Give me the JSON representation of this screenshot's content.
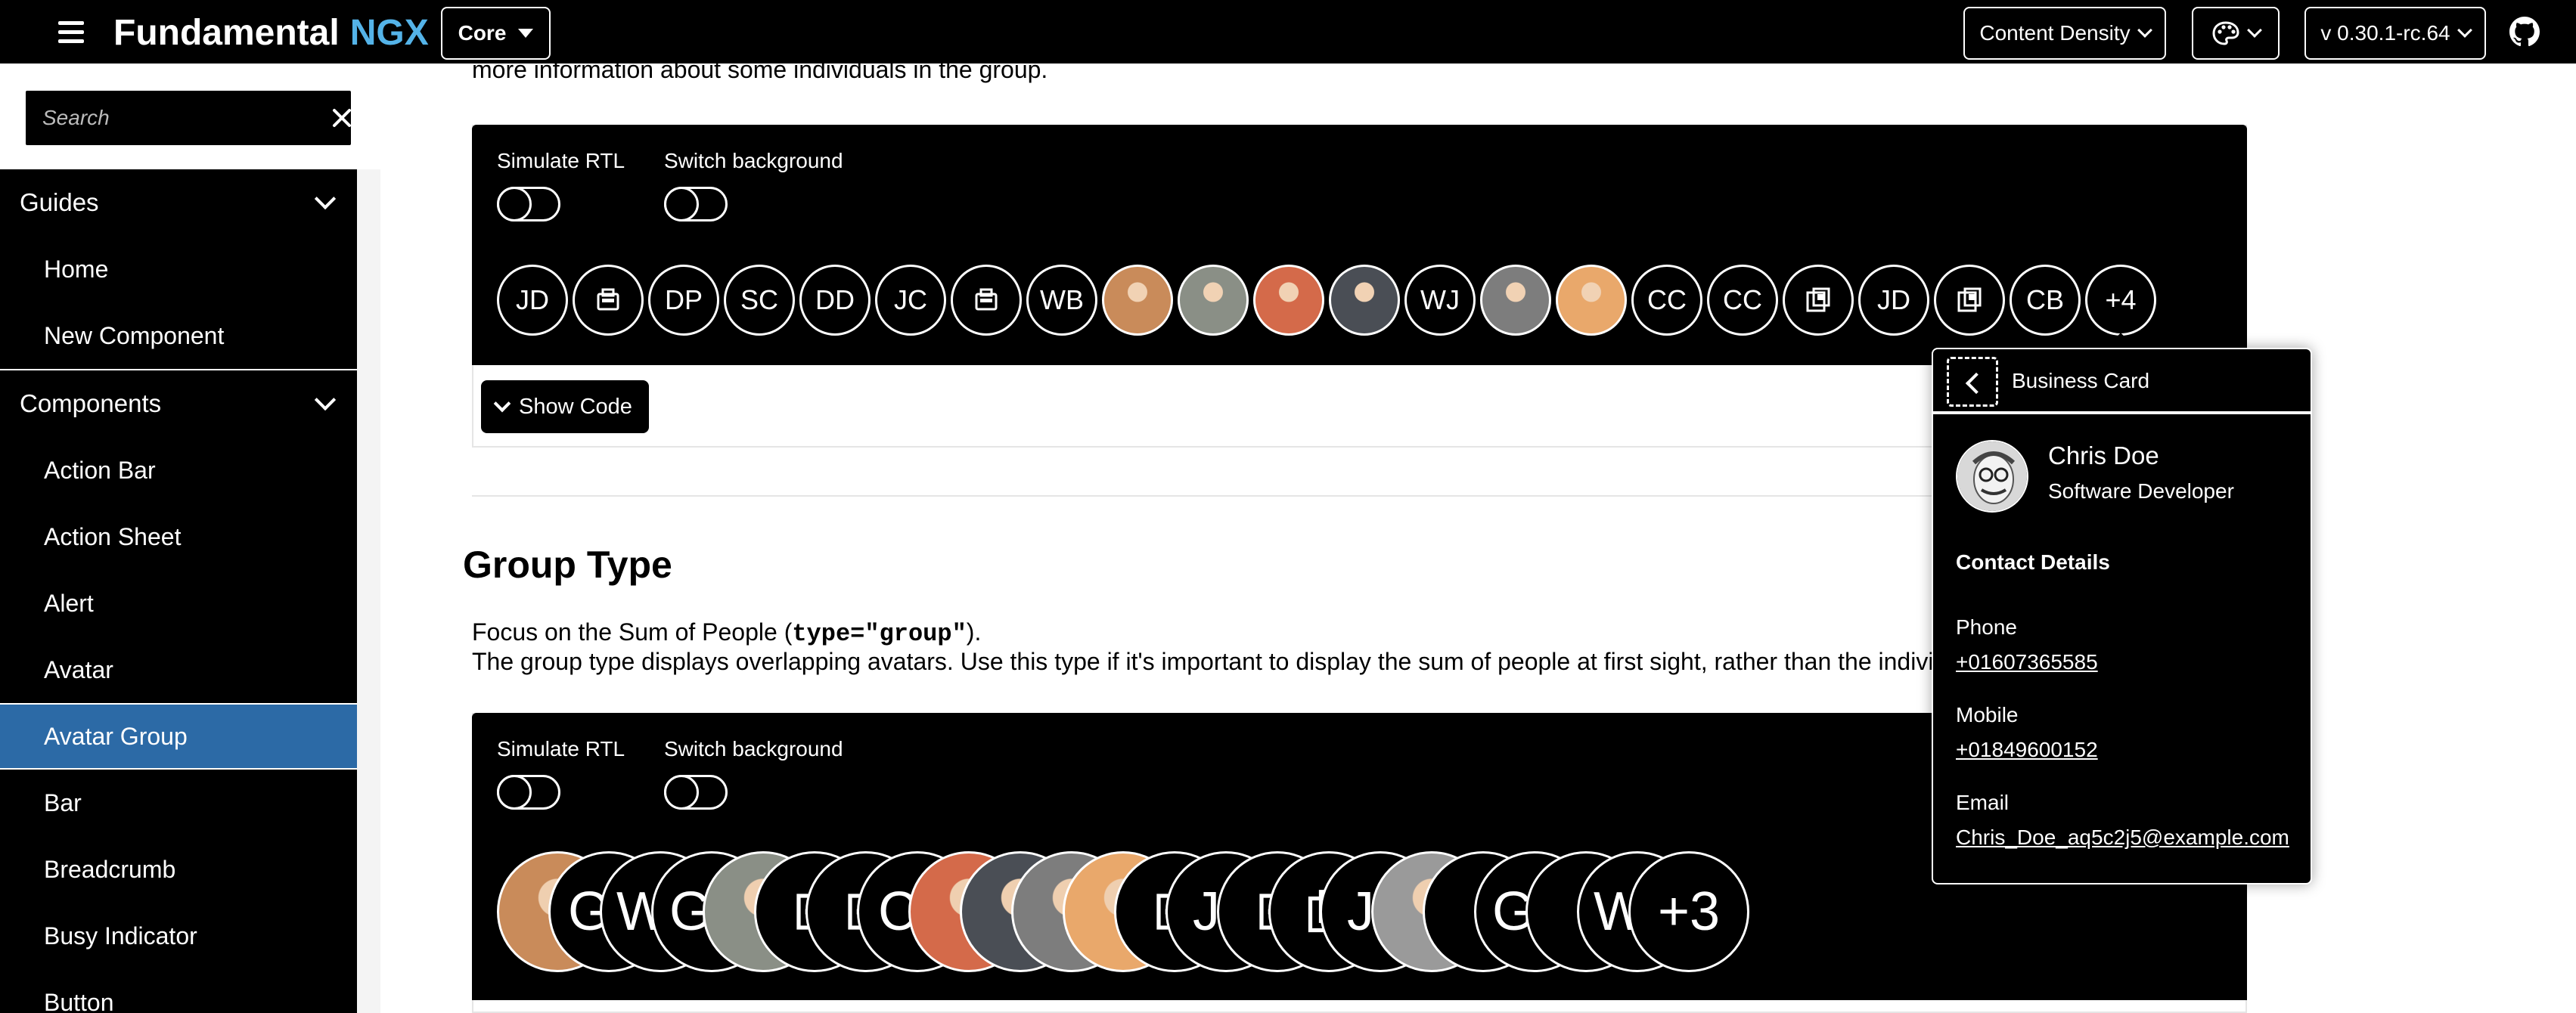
{
  "shellbar": {
    "brand_main": "Fundamental",
    "brand_accent": "NGX",
    "product": "Core",
    "content_density": "Content Density",
    "version": "v 0.30.1-rc.64",
    "icons": [
      "menu-icon",
      "palette-icon",
      "github-icon"
    ]
  },
  "search": {
    "placeholder": "Search"
  },
  "sidebar": {
    "guides_label": "Guides",
    "guides": [
      {
        "label": "Home"
      },
      {
        "label": "New Component"
      }
    ],
    "components_label": "Components",
    "components": [
      {
        "label": "Action Bar"
      },
      {
        "label": "Action Sheet"
      },
      {
        "label": "Alert"
      },
      {
        "label": "Avatar"
      },
      {
        "label": "Avatar Group"
      },
      {
        "label": "Bar"
      },
      {
        "label": "Breadcrumb"
      },
      {
        "label": "Busy Indicator"
      },
      {
        "label": "Button"
      }
    ],
    "active": "Avatar Group"
  },
  "main": {
    "intro": "more information about some individuals in the group.",
    "demo1": {
      "rtl_label": "Simulate RTL",
      "bg_label": "Switch background",
      "avatars": [
        "JD",
        "",
        "DP",
        "SC",
        "DD",
        "JC",
        "",
        "WB",
        "",
        "",
        "",
        "",
        "WJ",
        "",
        "",
        "CC",
        "CC",
        "",
        "JD",
        "",
        "CB",
        "+4"
      ]
    },
    "show_code": "Show Code",
    "section_title": "Group Type",
    "para_line1_a": "Focus on the Sum of People (",
    "para_code": "type=\"group\"",
    "para_line1_b": ").",
    "para_line2": "The group type displays overlapping avatars. Use this type if it's important to display the sum of people at first sight, rather than the individua",
    "demo2": {
      "rtl_label": "Simulate RTL",
      "bg_label": "Switch background",
      "avatars": [
        "",
        "GD",
        "WB",
        "GO",
        "",
        "",
        "",
        "CC",
        "",
        "",
        "",
        "",
        "",
        "JC",
        "",
        "",
        "JC",
        "",
        "",
        "GO",
        "",
        "WB",
        "+3"
      ]
    }
  },
  "business_card": {
    "title": "Business Card",
    "name": "Chris Doe",
    "role": "Software Developer",
    "section": "Contact Details",
    "phone_label": "Phone",
    "phone": "+01607365585",
    "mobile_label": "Mobile",
    "mobile": "+01849600152",
    "email_label": "Email",
    "email": "Chris_Doe_aq5c2j5@example.com"
  },
  "colors": {
    "accent_ngx": "#54b3e8",
    "active_nav": "#2c6aa6",
    "shell_bg": "#000000"
  }
}
